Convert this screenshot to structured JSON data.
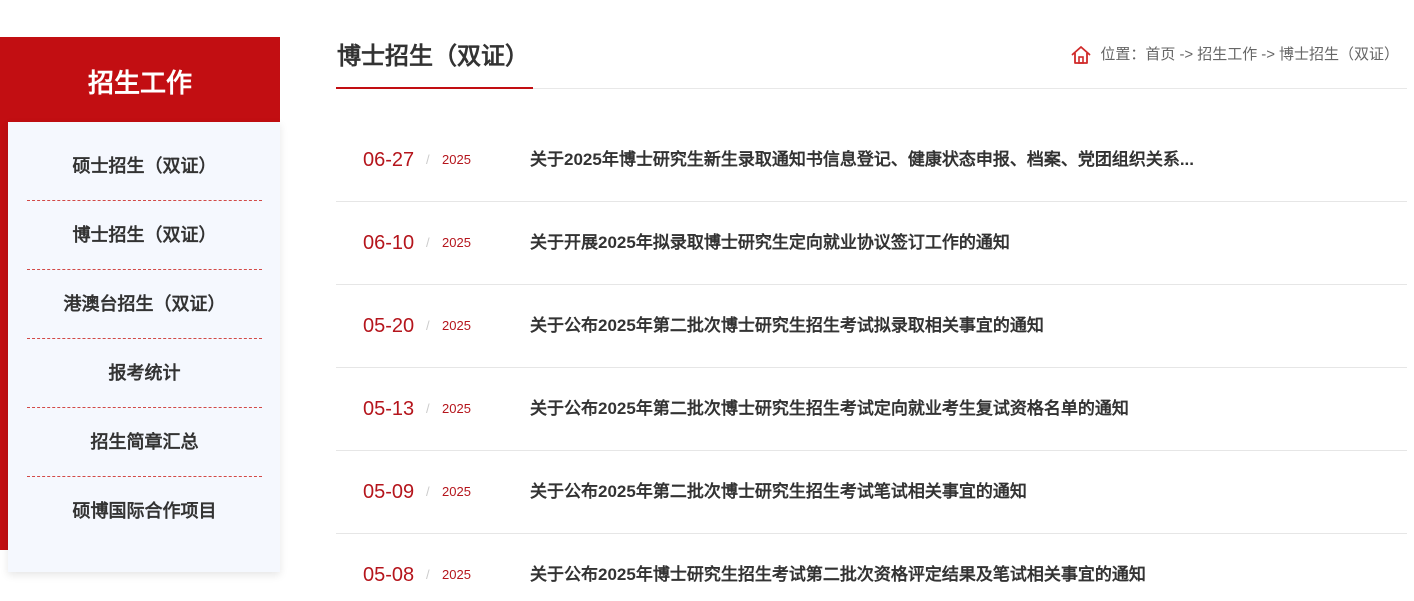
{
  "colors": {
    "brand_red": "#c20e12",
    "date_red": "#b5151c",
    "text_dark": "#333333",
    "text_gray": "#666666",
    "panel_bg": "#f5f8fe"
  },
  "sidebar": {
    "title": "招生工作",
    "items": [
      {
        "label": "硕士招生（双证）"
      },
      {
        "label": "博士招生（双证）"
      },
      {
        "label": "港澳台招生（双证）"
      },
      {
        "label": "报考统计"
      },
      {
        "label": "招生简章汇总"
      },
      {
        "label": "硕博国际合作项目"
      }
    ]
  },
  "main": {
    "title": "博士招生（双证）",
    "breadcrumb": {
      "icon": "home-icon",
      "prefix": "位置：",
      "separator": "->",
      "items": [
        "首页",
        "招生工作",
        "博士招生（双证）"
      ]
    }
  },
  "news": {
    "date_separator": "/",
    "items": [
      {
        "date": "06-27",
        "year": "2025",
        "title": "关于2025年博士研究生新生录取通知书信息登记、健康状态申报、档案、党团组织关系..."
      },
      {
        "date": "06-10",
        "year": "2025",
        "title": "关于开展2025年拟录取博士研究生定向就业协议签订工作的通知"
      },
      {
        "date": "05-20",
        "year": "2025",
        "title": "关于公布2025年第二批次博士研究生招生考试拟录取相关事宜的通知"
      },
      {
        "date": "05-13",
        "year": "2025",
        "title": "关于公布2025年第二批次博士研究生招生考试定向就业考生复试资格名单的通知"
      },
      {
        "date": "05-09",
        "year": "2025",
        "title": "关于公布2025年第二批次博士研究生招生考试笔试相关事宜的通知"
      },
      {
        "date": "05-08",
        "year": "2025",
        "title": "关于公布2025年博士研究生招生考试第二批次资格评定结果及笔试相关事宜的通知"
      }
    ]
  }
}
